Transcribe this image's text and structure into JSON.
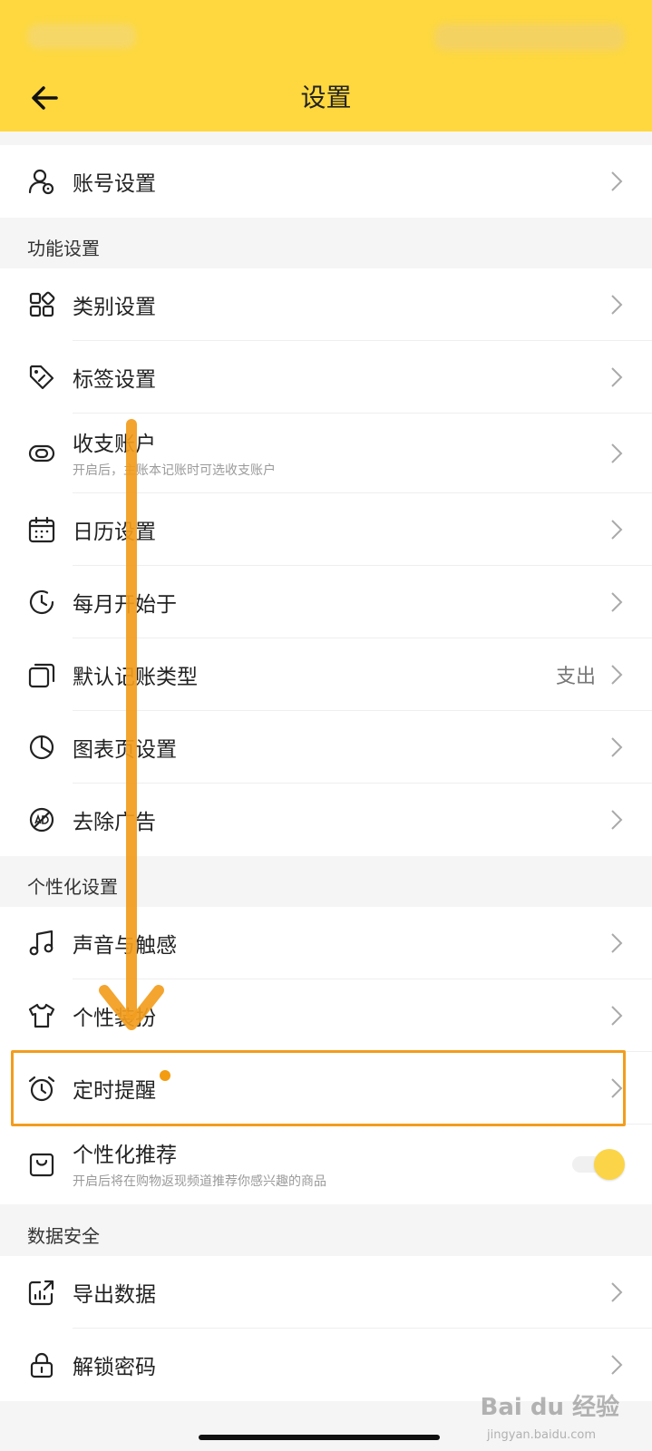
{
  "header": {
    "title": "设置",
    "back_icon": "arrow-left-icon",
    "color": "#fed83e"
  },
  "account": {
    "label": "账号设置",
    "icon": "user-gear-icon"
  },
  "sections": {
    "features": {
      "label": "功能设置",
      "items": [
        {
          "label": "类别设置",
          "icon": "grid-icon"
        },
        {
          "label": "标签设置",
          "icon": "tag-icon"
        },
        {
          "label": "收支账户",
          "sub": "开启后，主账本记账时可选收支账户",
          "icon": "link-icon"
        },
        {
          "label": "日历设置",
          "icon": "calendar-icon"
        },
        {
          "label": "每月开始于",
          "icon": "clock-icon"
        },
        {
          "label": "默认记账类型",
          "value": "支出",
          "icon": "layers-icon"
        },
        {
          "label": "图表页设置",
          "icon": "pie-chart-icon"
        },
        {
          "label": "去除广告",
          "icon": "no-ad-icon"
        }
      ]
    },
    "personal": {
      "label": "个性化设置",
      "items": [
        {
          "label": "声音与触感",
          "icon": "music-note-icon"
        },
        {
          "label": "个性装扮",
          "icon": "tshirt-icon"
        },
        {
          "label": "定时提醒",
          "icon": "alarm-clock-icon",
          "badge": true
        },
        {
          "label": "个性化推荐",
          "sub": "开启后将在购物返现频道推荐你感兴趣的商品",
          "icon": "shopping-bag-icon",
          "toggle": true
        }
      ]
    },
    "security": {
      "label": "数据安全",
      "items": [
        {
          "label": "导出数据",
          "icon": "export-chart-icon"
        },
        {
          "label": "解锁密码",
          "icon": "lock-icon"
        }
      ]
    }
  },
  "watermark": {
    "brand": "Bai du 经验",
    "url": "jingyan.baidu.com"
  },
  "colors": {
    "accent": "#fed83e",
    "annotation": "#f29d1d",
    "toggle_on": "#fbd547"
  }
}
